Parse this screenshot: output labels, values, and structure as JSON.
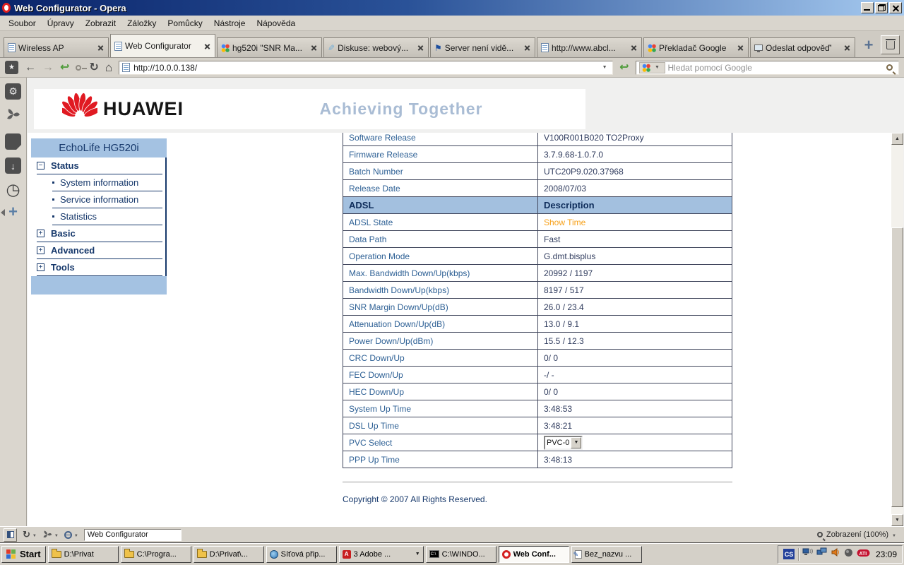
{
  "window": {
    "title": "Web Configurator - Opera"
  },
  "menu_bar": {
    "items": [
      "Soubor",
      "Úpravy",
      "Zobrazit",
      "Záložky",
      "Pomůcky",
      "Nástroje",
      "Nápověda"
    ]
  },
  "tab_bar": {
    "tabs": [
      {
        "label": "Wireless AP",
        "icon": "page-icon",
        "active": false
      },
      {
        "label": "Web Configurator",
        "icon": "page-icon",
        "active": true
      },
      {
        "label": "hg520i \"SNR Ma...",
        "icon": "google-icon",
        "active": false
      },
      {
        "label": "Diskuse: webový...",
        "icon": "quill-icon",
        "active": false
      },
      {
        "label": "Server není vidě...",
        "icon": "sail-flag-icon",
        "active": false
      },
      {
        "label": "http://www.abcl...",
        "icon": "page-icon",
        "active": false
      },
      {
        "label": "Překladač Google",
        "icon": "google-icon",
        "active": false
      },
      {
        "label": "Odeslat odpověď'",
        "icon": "monitor-icon",
        "active": false
      }
    ]
  },
  "address_bar": {
    "url": "http://10.0.0.138/",
    "search_placeholder": "Hledat pomocí Google"
  },
  "sidebar_panel_icons": [
    "gear-icon",
    "unite-swirl-icon",
    "notes-icon",
    "downloads-icon",
    "history-clock-icon",
    "add-panel-icon"
  ],
  "router_page": {
    "brand": "HUAWEI",
    "slogan": "Achieving Together",
    "nav_title": "EchoLife HG520i",
    "nav_items": [
      {
        "label": "Status",
        "type": "section",
        "state": "expanded"
      },
      {
        "label": "System information",
        "type": "sub"
      },
      {
        "label": "Service information",
        "type": "sub"
      },
      {
        "label": "Statistics",
        "type": "sub"
      },
      {
        "label": "Basic",
        "type": "section",
        "state": "collapsed"
      },
      {
        "label": "Advanced",
        "type": "section",
        "state": "collapsed"
      },
      {
        "label": "Tools",
        "type": "section",
        "state": "collapsed"
      }
    ],
    "table_rows": [
      {
        "label": "Software Release",
        "value": "V100R001B020 TO2Proxy"
      },
      {
        "label": "Firmware Release",
        "value": "3.7.9.68-1.0.7.0"
      },
      {
        "label": "Batch Number",
        "value": "UTC20P9.020.37968"
      },
      {
        "label": "Release Date",
        "value": "2008/07/03"
      },
      {
        "label": "ADSL",
        "value": "Description",
        "type": "header"
      },
      {
        "label": "ADSL State",
        "value": "Show Time",
        "type": "highlight"
      },
      {
        "label": "Data Path",
        "value": "Fast"
      },
      {
        "label": "Operation Mode",
        "value": "G.dmt.bisplus"
      },
      {
        "label": "Max. Bandwidth Down/Up(kbps)",
        "value": "20992 / 1197"
      },
      {
        "label": "Bandwidth Down/Up(kbps)",
        "value": "8197 / 517"
      },
      {
        "label": "SNR Margin Down/Up(dB)",
        "value": "26.0 / 23.4"
      },
      {
        "label": "Attenuation Down/Up(dB)",
        "value": "13.0 / 9.1"
      },
      {
        "label": "Power Down/Up(dBm)",
        "value": "15.5 / 12.3"
      },
      {
        "label": "CRC Down/Up",
        "value": "0/ 0"
      },
      {
        "label": "FEC Down/Up",
        "value": "-/ -"
      },
      {
        "label": "HEC Down/Up",
        "value": "0/ 0"
      },
      {
        "label": "System Up Time",
        "value": "3:48:53"
      },
      {
        "label": "DSL Up Time",
        "value": "3:48:21"
      },
      {
        "label": "PVC Select",
        "value": "PVC-0",
        "type": "select"
      },
      {
        "label": "PPP Up Time",
        "value": "3:48:13"
      }
    ],
    "copyright": "Copyright © 2007 All Rights Reserved."
  },
  "status_bar": {
    "page_field": "Web Configurator",
    "zoom_label": "Zobrazení (100%)"
  },
  "taskbar": {
    "start_label": "Start",
    "buttons": [
      {
        "label": "D:\\Privat",
        "icon": "folder-icon",
        "active": false
      },
      {
        "label": "C:\\Progra...",
        "icon": "folder-icon",
        "active": false
      },
      {
        "label": "D:\\Privat\\...",
        "icon": "folder-icon",
        "active": false
      },
      {
        "label": "Síťová přip...",
        "icon": "network-globe-icon",
        "active": false
      },
      {
        "label": "3 Adobe ...",
        "icon": "adobe-pdf-icon",
        "active": false,
        "grouped": true
      },
      {
        "label": "C:\\WINDO...",
        "icon": "console-icon",
        "active": false
      },
      {
        "label": "Web Conf...",
        "icon": "opera-icon",
        "active": true
      },
      {
        "label": "Bez_nazvu ...",
        "icon": "notepad-icon",
        "active": false
      }
    ],
    "tray": {
      "language_badge": "CS",
      "clock": "23:09"
    }
  },
  "colors": {
    "titlebar_start": "#0a246a",
    "titlebar_end": "#a6caf0",
    "chrome_gray": "#d6d2ca",
    "nav_blue": "#a4c2e2",
    "nav_text": "#16386b",
    "table_header_blue": "#a3c0df",
    "link_orange": "#f7a11a",
    "huawei_red": "#e01a22",
    "slogan_blue": "#a9bcd4"
  }
}
